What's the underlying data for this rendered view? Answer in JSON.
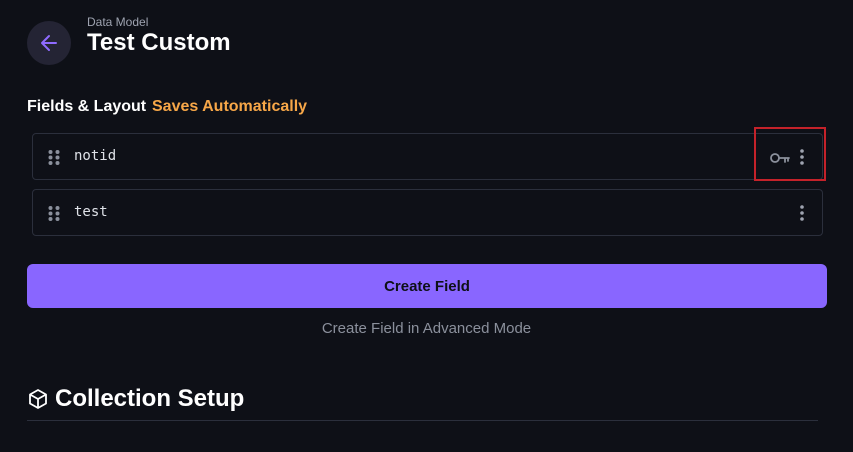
{
  "header": {
    "breadcrumb": "Data Model",
    "title": "Test Custom"
  },
  "fields_section": {
    "label": "Fields & Layout",
    "status": "Saves Automatically",
    "fields": [
      {
        "name": "notid",
        "is_primary_key": true
      },
      {
        "name": "test",
        "is_primary_key": false
      }
    ]
  },
  "actions": {
    "create_field": "Create Field",
    "create_field_advanced": "Create Field in Advanced Mode"
  },
  "collection_setup": {
    "title": "Collection Setup"
  },
  "colors": {
    "background": "#0e1017",
    "accent": "#8966ff",
    "warning": "#f7a748",
    "highlight": "#c4222a"
  },
  "icons": {
    "back": "arrow-left-icon",
    "drag": "drag-handle-icon",
    "key": "key-icon",
    "more": "more-vertical-icon",
    "cube": "cube-icon"
  }
}
